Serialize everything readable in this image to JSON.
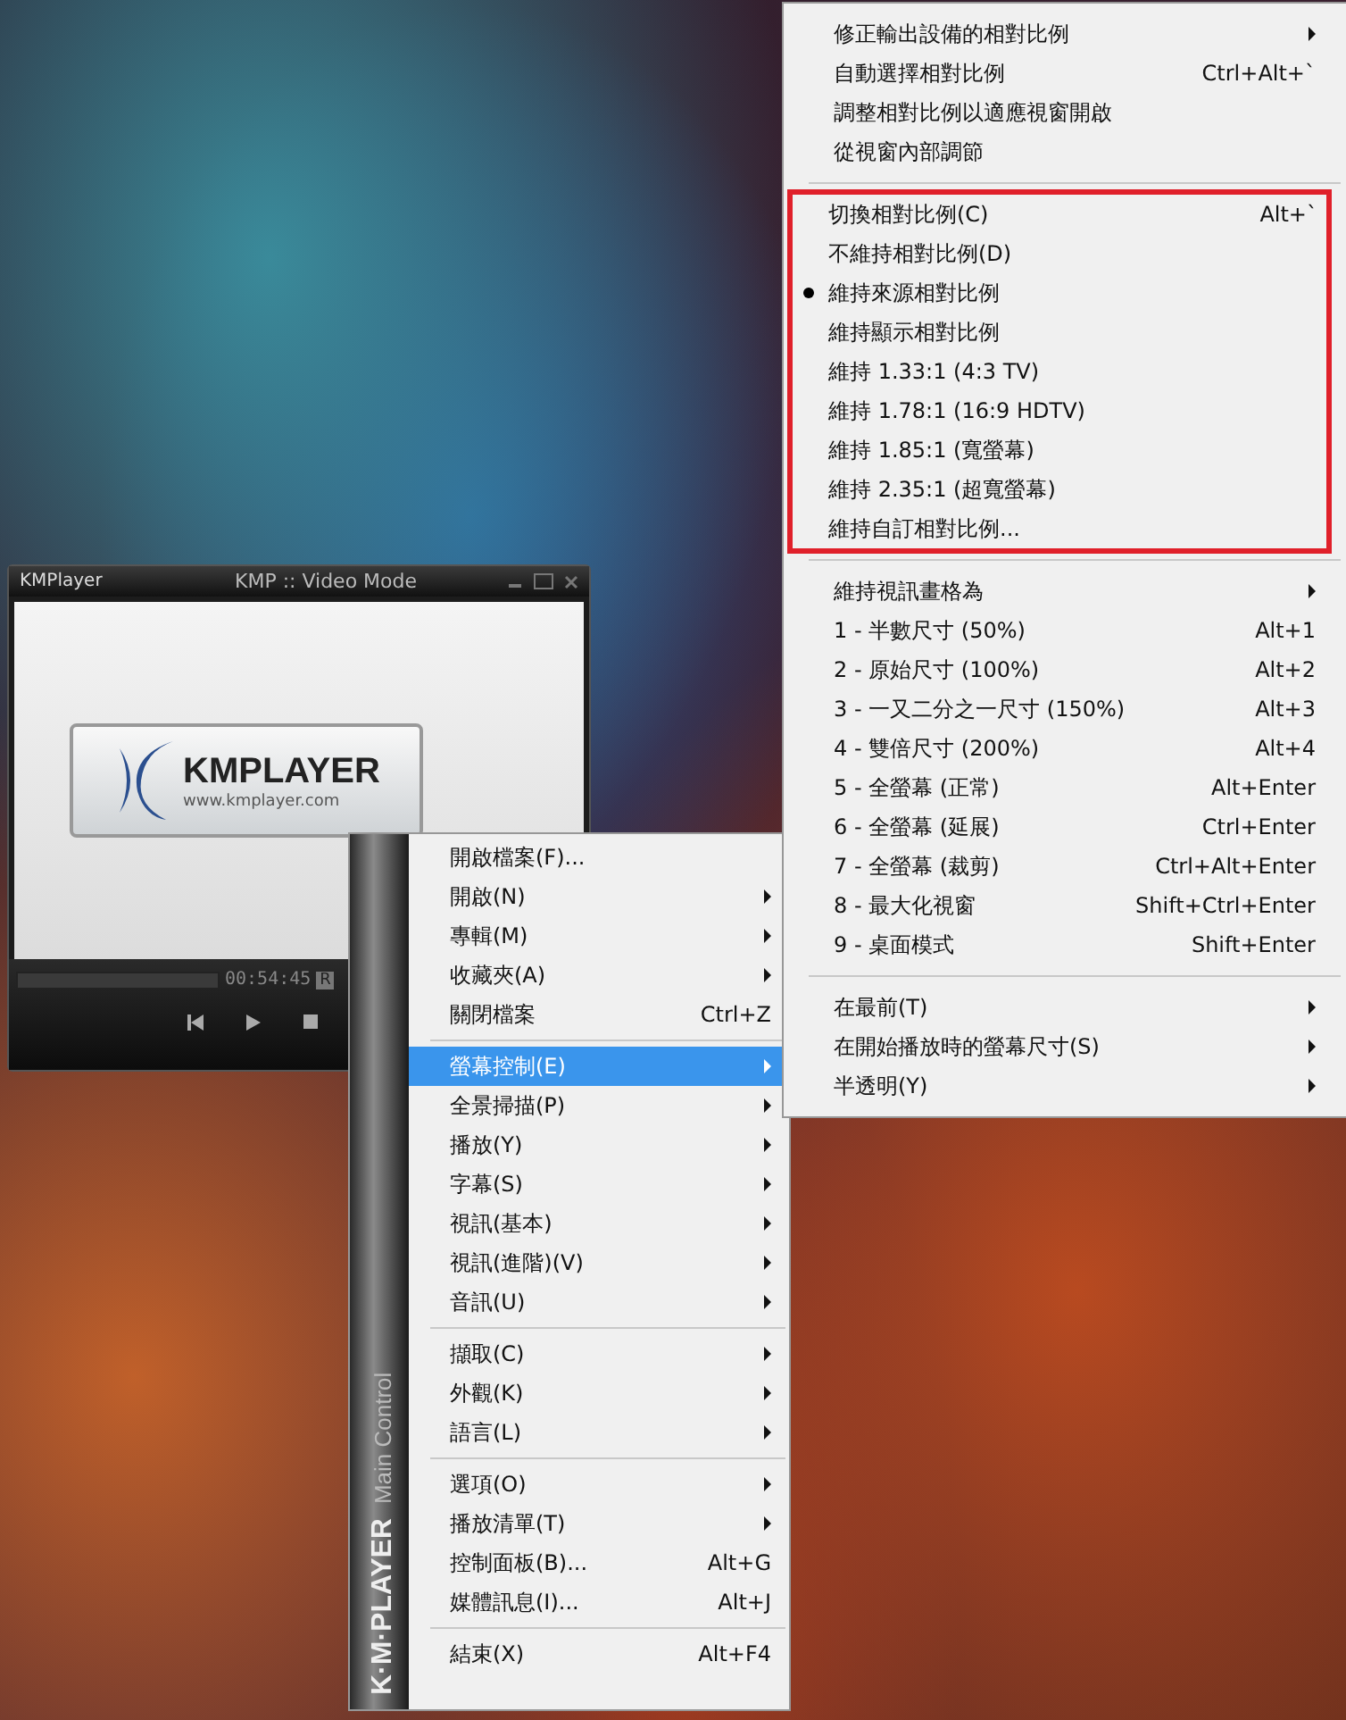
{
  "player": {
    "app_name": "KMPlayer",
    "title": "KMP :: Video Mode",
    "logo_text": "KMPLAYER",
    "logo_url": "www.kmplayer.com",
    "time": "00:54:45",
    "badge": "R"
  },
  "main_menu": {
    "brand": "K·M·PLAYER",
    "caption": "Main Control",
    "sections": [
      {
        "items": [
          {
            "label": "開啟檔案(F)...",
            "has_submenu": false,
            "selected": false
          },
          {
            "label": "開啟(N)",
            "has_submenu": true,
            "selected": false
          },
          {
            "label": "專輯(M)",
            "has_submenu": true,
            "selected": false
          },
          {
            "label": "收藏夾(A)",
            "has_submenu": true,
            "selected": false
          },
          {
            "label": "關閉檔案",
            "shortcut": "Ctrl+Z",
            "has_submenu": false,
            "selected": false
          }
        ]
      },
      {
        "items": [
          {
            "label": "螢幕控制(E)",
            "has_submenu": true,
            "selected": true
          },
          {
            "label": "全景掃描(P)",
            "has_submenu": true,
            "selected": false
          },
          {
            "label": "播放(Y)",
            "has_submenu": true,
            "selected": false
          },
          {
            "label": "字幕(S)",
            "has_submenu": true,
            "selected": false
          },
          {
            "label": "視訊(基本)",
            "has_submenu": true,
            "selected": false
          },
          {
            "label": "視訊(進階)(V)",
            "has_submenu": true,
            "selected": false
          },
          {
            "label": "音訊(U)",
            "has_submenu": true,
            "selected": false
          }
        ]
      },
      {
        "items": [
          {
            "label": "擷取(C)",
            "has_submenu": true,
            "selected": false
          },
          {
            "label": "外觀(K)",
            "has_submenu": true,
            "selected": false
          },
          {
            "label": "語言(L)",
            "has_submenu": true,
            "selected": false
          }
        ]
      },
      {
        "items": [
          {
            "label": "選項(O)",
            "has_submenu": true,
            "selected": false
          },
          {
            "label": "播放清單(T)",
            "has_submenu": true,
            "selected": false
          },
          {
            "label": "控制面板(B)...",
            "shortcut": "Alt+G",
            "has_submenu": false,
            "selected": false
          },
          {
            "label": "媒體訊息(I)...",
            "shortcut": "Alt+J",
            "has_submenu": false,
            "selected": false
          }
        ]
      },
      {
        "items": [
          {
            "label": "結束(X)",
            "shortcut": "Alt+F4",
            "has_submenu": false,
            "selected": false
          }
        ]
      }
    ]
  },
  "submenu": {
    "sections": [
      {
        "highlighted": false,
        "items": [
          {
            "label": "修正輸出設備的相對比例",
            "has_submenu": true,
            "checked": false
          },
          {
            "label": "自動選擇相對比例",
            "shortcut": "Ctrl+Alt+`",
            "has_submenu": false,
            "checked": false
          },
          {
            "label": "調整相對比例以適應視窗開啟",
            "has_submenu": false,
            "checked": false
          },
          {
            "label": "從視窗內部調節",
            "has_submenu": false,
            "checked": false
          }
        ]
      },
      {
        "highlighted": true,
        "items": [
          {
            "label": "切換相對比例(C)",
            "shortcut": "Alt+`",
            "has_submenu": false,
            "checked": false
          },
          {
            "label": "不維持相對比例(D)",
            "has_submenu": false,
            "checked": false
          },
          {
            "label": "維持來源相對比例",
            "has_submenu": false,
            "checked": true
          },
          {
            "label": "維持顯示相對比例",
            "has_submenu": false,
            "checked": false
          },
          {
            "label": "維持 1.33:1 (4:3 TV)",
            "has_submenu": false,
            "checked": false
          },
          {
            "label": "維持 1.78:1 (16:9 HDTV)",
            "has_submenu": false,
            "checked": false
          },
          {
            "label": "維持 1.85:1 (寬螢幕)",
            "has_submenu": false,
            "checked": false
          },
          {
            "label": "維持 2.35:1 (超寬螢幕)",
            "has_submenu": false,
            "checked": false
          },
          {
            "label": "維持自訂相對比例...",
            "has_submenu": false,
            "checked": false
          }
        ]
      },
      {
        "highlighted": false,
        "items": [
          {
            "label": "維持視訊畫格為",
            "has_submenu": true,
            "checked": false
          },
          {
            "label": "1 - 半數尺寸 (50%)",
            "shortcut": "Alt+1",
            "has_submenu": false,
            "checked": false
          },
          {
            "label": "2 - 原始尺寸 (100%)",
            "shortcut": "Alt+2",
            "has_submenu": false,
            "checked": false
          },
          {
            "label": "3 - 一又二分之一尺寸 (150%)",
            "shortcut": "Alt+3",
            "has_submenu": false,
            "checked": false
          },
          {
            "label": "4 - 雙倍尺寸 (200%)",
            "shortcut": "Alt+4",
            "has_submenu": false,
            "checked": false
          },
          {
            "label": "5 - 全螢幕 (正常)",
            "shortcut": "Alt+Enter",
            "has_submenu": false,
            "checked": false
          },
          {
            "label": "6 - 全螢幕 (延展)",
            "shortcut": "Ctrl+Enter",
            "has_submenu": false,
            "checked": false
          },
          {
            "label": "7 - 全螢幕 (裁剪)",
            "shortcut": "Ctrl+Alt+Enter",
            "has_submenu": false,
            "checked": false
          },
          {
            "label": "8 - 最大化視窗",
            "shortcut": "Shift+Ctrl+Enter",
            "has_submenu": false,
            "checked": false
          },
          {
            "label": "9 - 桌面模式",
            "shortcut": "Shift+Enter",
            "has_submenu": false,
            "checked": false
          }
        ]
      },
      {
        "highlighted": false,
        "items": [
          {
            "label": "在最前(T)",
            "has_submenu": true,
            "checked": false
          },
          {
            "label": "在開始播放時的螢幕尺寸(S)",
            "has_submenu": true,
            "checked": false
          },
          {
            "label": "半透明(Y)",
            "has_submenu": true,
            "checked": false
          }
        ]
      }
    ]
  }
}
